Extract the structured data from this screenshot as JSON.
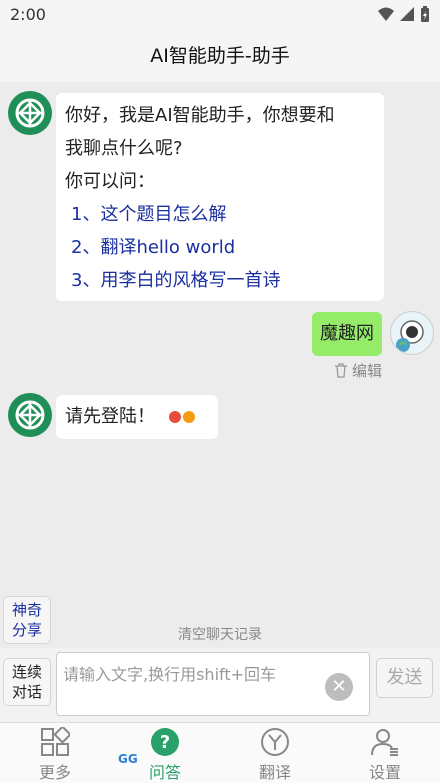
{
  "status": {
    "time": "2:00"
  },
  "header": {
    "title": "AI智能助手-助手"
  },
  "chat": {
    "ai_intro": {
      "line1": "你好，我是AI智能助手，你想要和",
      "line2": "我聊点什么呢?",
      "line3": "你可以问：",
      "suggestions": [
        "1、这个题目怎么解",
        "2、翻译hello world",
        "3、用李白的风格写一首诗"
      ]
    },
    "user_message": {
      "text": "魔趣网",
      "edit_label": "编辑"
    },
    "ai_reply": {
      "text": "请先登陆！"
    }
  },
  "side_buttons": {
    "magic_share": [
      "神奇",
      "分享"
    ],
    "continuous": [
      "连续",
      "对话"
    ]
  },
  "clear_history_label": "清空聊天记录",
  "input": {
    "placeholder": "请输入文字,换行用shift+回车",
    "send_label": "发送"
  },
  "tabs": [
    {
      "label": "更多",
      "icon": "grid-icon"
    },
    {
      "label": "问答",
      "icon": "question-icon"
    },
    {
      "label": "翻译",
      "icon": "translate-icon"
    },
    {
      "label": "设置",
      "icon": "user-settings-icon"
    }
  ],
  "colors": {
    "accent": "#2aa06a",
    "user_bubble": "#95ec69",
    "link": "#1a2fa0",
    "loader_red": "#e74c3c",
    "loader_orange": "#f39c12"
  }
}
